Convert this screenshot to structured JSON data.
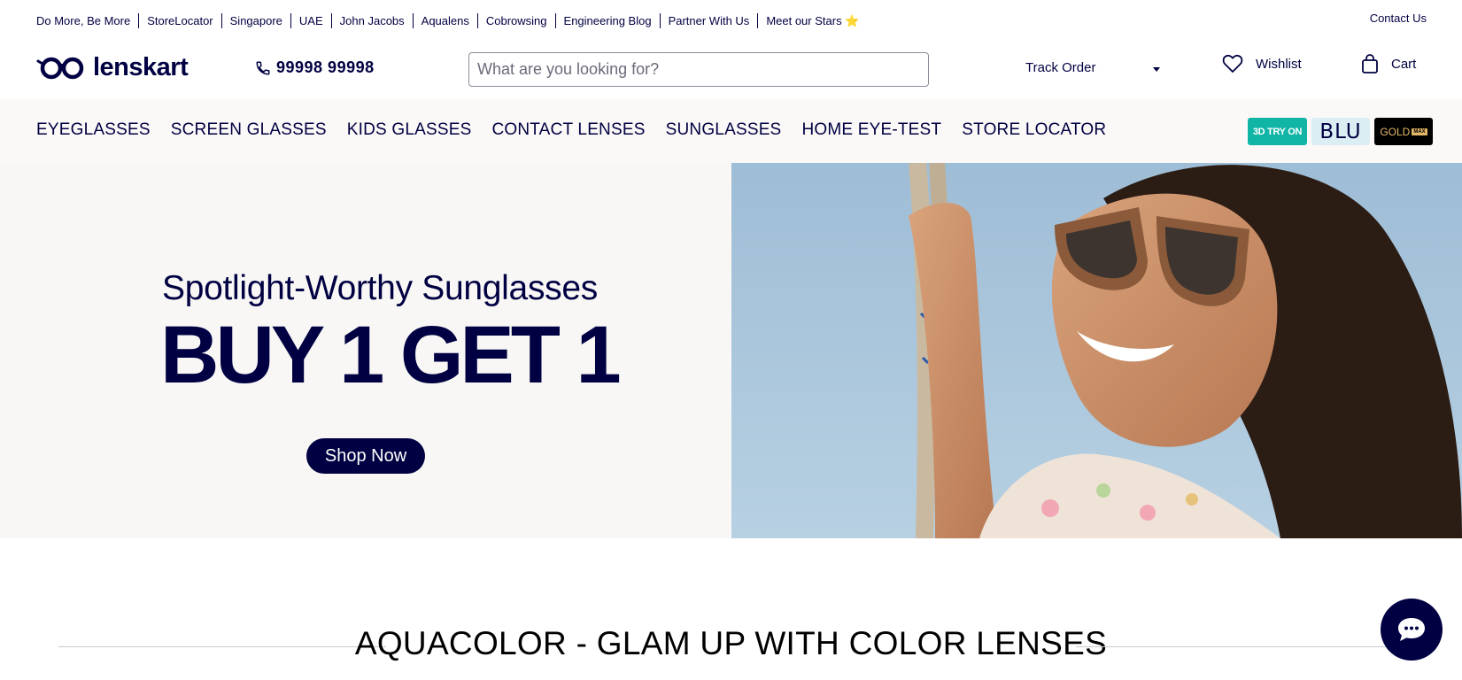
{
  "top_links": [
    "Do More, Be More",
    "StoreLocator",
    "Singapore",
    "UAE",
    "John Jacobs",
    "Aqualens",
    "Cobrowsing",
    "Engineering Blog",
    "Partner With Us",
    "Meet our Stars ⭐"
  ],
  "contact_label": "Contact Us",
  "logo_text": "lenskart",
  "phone": "99998 99998",
  "search": {
    "placeholder": "What are you looking for?"
  },
  "track_order_label": "Track Order",
  "wishlist_label": "Wishlist",
  "cart_label": "Cart",
  "nav_items": [
    "EYEGLASSES",
    "SCREEN GLASSES",
    "KIDS GLASSES",
    "CONTACT LENSES",
    "SUNGLASSES",
    "HOME EYE-TEST",
    "STORE LOCATOR"
  ],
  "badges": {
    "try_on": "3D TRY ON",
    "blu": "BLU",
    "gold": "GOLD",
    "gold_tag": "MAX"
  },
  "hero": {
    "subtitle": "Spotlight-Worthy Sunglasses",
    "title": "BUY 1 GET 1",
    "cta": "Shop Now"
  },
  "section_title": "AQUACOLOR - GLAM UP WITH COLOR LENSES",
  "colors": {
    "brand_navy": "#000042",
    "teal": "#11b5a6",
    "gold": "#e3b768"
  }
}
